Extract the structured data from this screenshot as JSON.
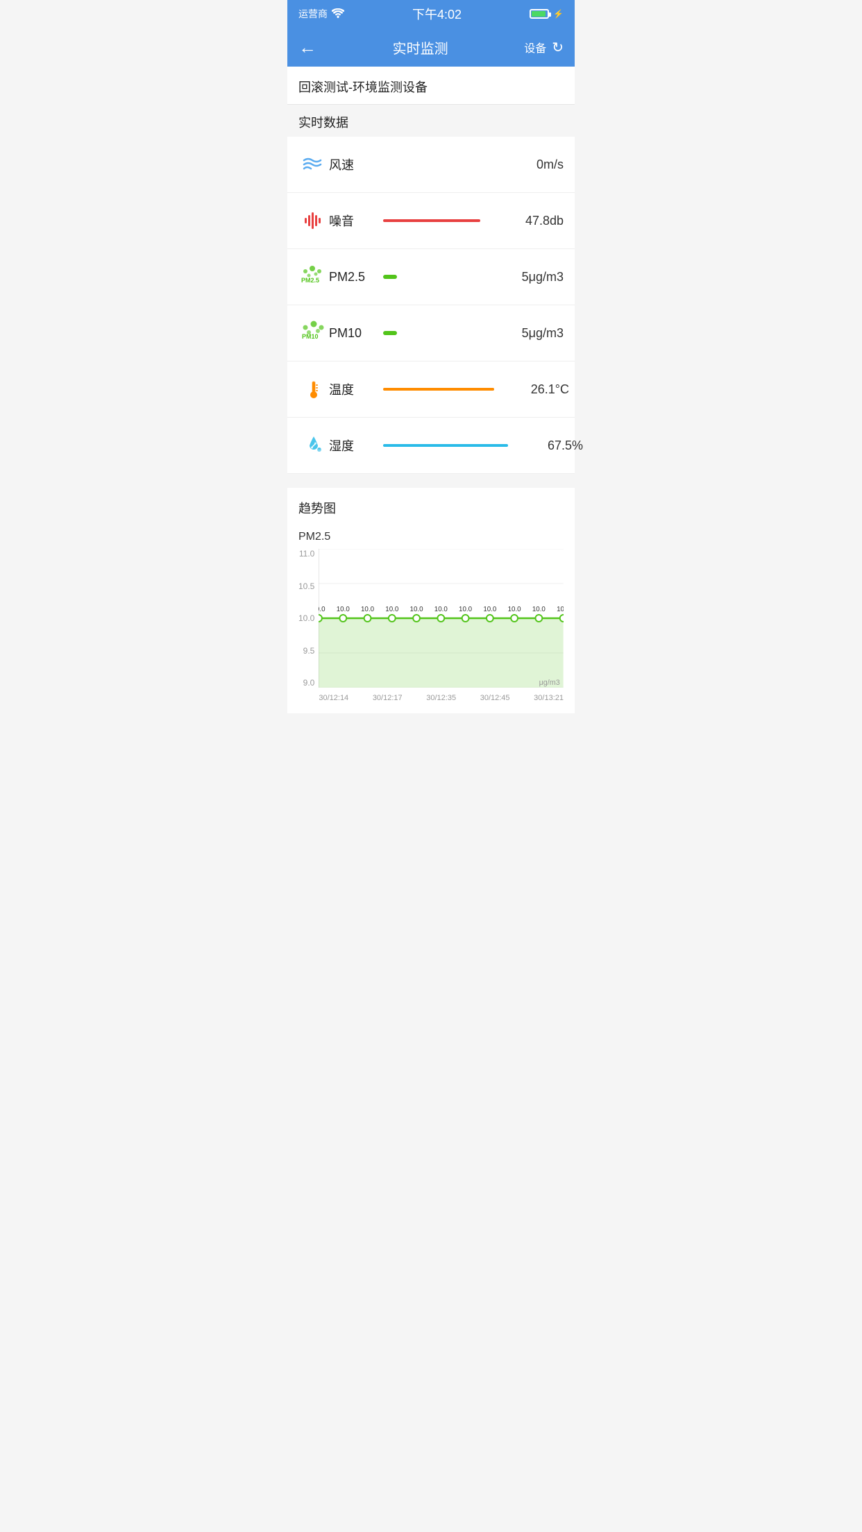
{
  "statusBar": {
    "carrier": "运营商",
    "time": "下午4:02",
    "wifiIcon": "wifi",
    "batteryIcon": "battery"
  },
  "navBar": {
    "backIcon": "←",
    "title": "实时监测",
    "rightLabel": "设备",
    "refreshIcon": "↻"
  },
  "deviceTitle": "回滚测试-环境监测设备",
  "realtimeSection": {
    "label": "实时数据",
    "items": [
      {
        "id": "wind",
        "icon": "wind-icon",
        "name": "风速",
        "indicator": "none",
        "value": "0m/s"
      },
      {
        "id": "noise",
        "icon": "noise-icon",
        "name": "噪音",
        "indicator": "line-red",
        "value": "47.8db"
      },
      {
        "id": "pm25",
        "icon": "pm25-icon",
        "name": "PM2.5",
        "indicator": "dot-green",
        "value": "5μg/m3"
      },
      {
        "id": "pm10",
        "icon": "pm10-icon",
        "name": "PM10",
        "indicator": "dot-green",
        "value": "5μg/m3"
      },
      {
        "id": "temp",
        "icon": "temp-icon",
        "name": "温度",
        "indicator": "line-orange",
        "value": "26.1°C"
      },
      {
        "id": "humidity",
        "icon": "humidity-icon",
        "name": "湿度",
        "indicator": "line-blue",
        "value": "67.5%"
      }
    ]
  },
  "chartSection": {
    "sectionLabel": "趋势图",
    "chartTitle": "PM2.5",
    "yAxis": {
      "max": "11.0",
      "mid1": "10.5",
      "mid2": "10.0",
      "mid3": "9.5",
      "min": "9.0"
    },
    "unit": "μg/m3",
    "dataPoints": [
      10.0,
      10.0,
      10.0,
      10.0,
      10.0,
      10.0,
      10.0,
      10.0,
      10.0,
      10.0
    ],
    "xLabels": [
      "30/12:14",
      "30/12:17",
      "30/12:35",
      "30/12:45",
      "30/13:21"
    ],
    "lineColor": "#52c41a",
    "fillColor": "rgba(82, 196, 26, 0.15)"
  }
}
